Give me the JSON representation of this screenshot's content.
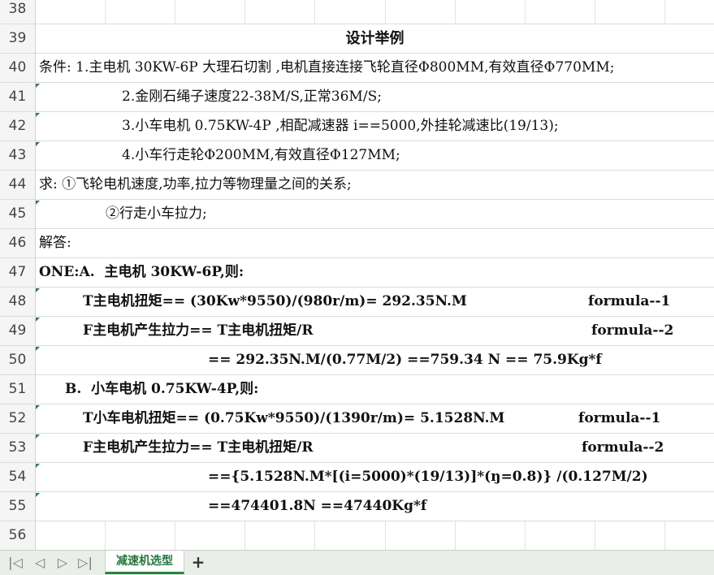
{
  "sheet": {
    "rows": [
      {
        "n": "38",
        "text": "",
        "style": "grid"
      },
      {
        "n": "39",
        "text": "设计举例",
        "style": "title"
      },
      {
        "n": "40",
        "text": "条件: 1.主电机 30KW-6P 大理石切割 ,电机直接连接飞轮直径Φ800MM,有效直径Φ770MM;",
        "style": "normal",
        "indent": 4
      },
      {
        "n": "41",
        "text": "2.金刚石绳子速度22-38M/S,正常36M/S;",
        "style": "normal",
        "indent": 106,
        "mark": true
      },
      {
        "n": "42",
        "text": "3.小车电机 0.75KW-4P ,相配减速器 i==5000,外挂轮减速比(19/13);",
        "style": "normal",
        "indent": 106,
        "mark": true
      },
      {
        "n": "43",
        "text": "4.小车行走轮Φ200MM,有效直径Φ127MM;",
        "style": "normal",
        "indent": 106,
        "mark": true
      },
      {
        "n": "44",
        "text": "求: ①飞轮电机速度,功率,拉力等物理量之间的关系;",
        "style": "normal",
        "indent": 4
      },
      {
        "n": "45",
        "text": "②行走小车拉力;",
        "style": "normal",
        "indent": 86,
        "mark": true
      },
      {
        "n": "46",
        "text": "解答:",
        "style": "normal",
        "indent": 4
      },
      {
        "n": "47",
        "text": "ONE:A.  主电机 30KW-6P,则:",
        "style": "bold",
        "indent": 4
      },
      {
        "n": "48",
        "text": "T主电机扭矩== (30Kw*9550)/(980r/m)= 292.35N.M",
        "style": "bold",
        "indent": 58,
        "mark": true,
        "extra": "formula--1",
        "extraLeft": 724
      },
      {
        "n": "49",
        "text": "F主电机产生拉力== T主电机扭矩/R",
        "style": "bold",
        "indent": 58,
        "mark": true,
        "extra": "formula--2",
        "extraLeft": 728
      },
      {
        "n": "50",
        "text": "== 292.35N.M/(0.77M/2) ==759.34 N == 75.9Kg*f",
        "style": "bold",
        "indent": 212,
        "mark": true
      },
      {
        "n": "51",
        "text": "B.  小车电机 0.75KW-4P,则:",
        "style": "bold",
        "indent": 36
      },
      {
        "n": "52",
        "text": "T小车电机扭矩== (0.75Kw*9550)/(1390r/m)= 5.1528N.M",
        "style": "bold",
        "indent": 58,
        "mark": true,
        "extra": "formula--1",
        "extraLeft": 712
      },
      {
        "n": "53",
        "text": "F主电机产生拉力== T主电机扭矩/R",
        "style": "bold",
        "indent": 58,
        "mark": true,
        "extra": "formula--2",
        "extraLeft": 716
      },
      {
        "n": "54",
        "text": "=={5.1528N.M*[(i=5000)*(19/13)]*(ŋ=0.8)} /(0.127M/2)",
        "style": "bold",
        "indent": 212,
        "mark": true
      },
      {
        "n": "55",
        "text": "==474401.8N ==47440Kg*f",
        "style": "bold",
        "indent": 212,
        "mark": true
      },
      {
        "n": "56",
        "text": "",
        "style": "empty"
      }
    ]
  },
  "footer": {
    "nav_first": "|◁",
    "nav_prev": "◁",
    "nav_next": "▷",
    "nav_last": "▷|",
    "active_tab": "减速机选型",
    "add_tab": "+",
    "accent": "#1f8a3b"
  }
}
